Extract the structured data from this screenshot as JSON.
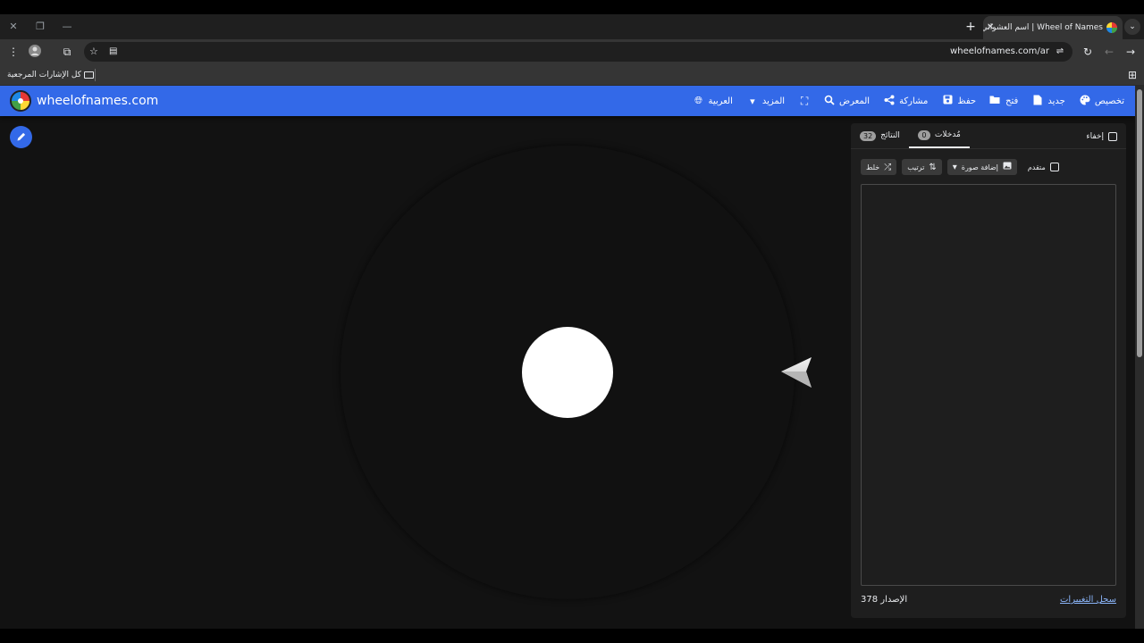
{
  "browser": {
    "tab_title": "Wheel of Names | اسم العشوائي",
    "tab_close": "✕",
    "new_tab": "+",
    "url": "wheelofnames.com/ar",
    "window_minimize": "—",
    "window_restore": "❐",
    "window_close": "✕",
    "bookmarks_folder": "كل الإشارات المرجعية"
  },
  "app": {
    "site_title": "wheelofnames.com",
    "nav": {
      "language": "العربية",
      "more": "المزيد",
      "fullscreen": "",
      "gallery": "المعرض",
      "share": "مشاركة",
      "save": "حفظ",
      "open": "فتح",
      "new": "جديد",
      "customize": "تخصيص"
    },
    "panel": {
      "hide_label": "إخفاء",
      "tabs": [
        {
          "label": "مُدخلات",
          "count": "0"
        },
        {
          "label": "النتائج",
          "count": "32"
        }
      ],
      "controls": {
        "shuffle": "خلط",
        "sort": "ترتيب",
        "add_image": "إضافة صورة",
        "advanced": "متقدم"
      },
      "entries_value": "",
      "version_label": "الإصدار",
      "version_number": "378",
      "changelog": "سجل التغييرات"
    }
  },
  "colors": {
    "app_bar": "#3369e8",
    "page_bg": "#121212",
    "panel_bg": "#1e1e1e",
    "link": "#8ab4f8"
  },
  "icons": [
    "globe-icon",
    "caret-down-icon",
    "fullscreen-icon",
    "search-icon",
    "share-icon",
    "save-icon",
    "folder-open-icon",
    "file-icon",
    "palette-icon",
    "pencil-icon",
    "shuffle-icon",
    "sort-icon",
    "image-icon",
    "pointer-icon"
  ]
}
